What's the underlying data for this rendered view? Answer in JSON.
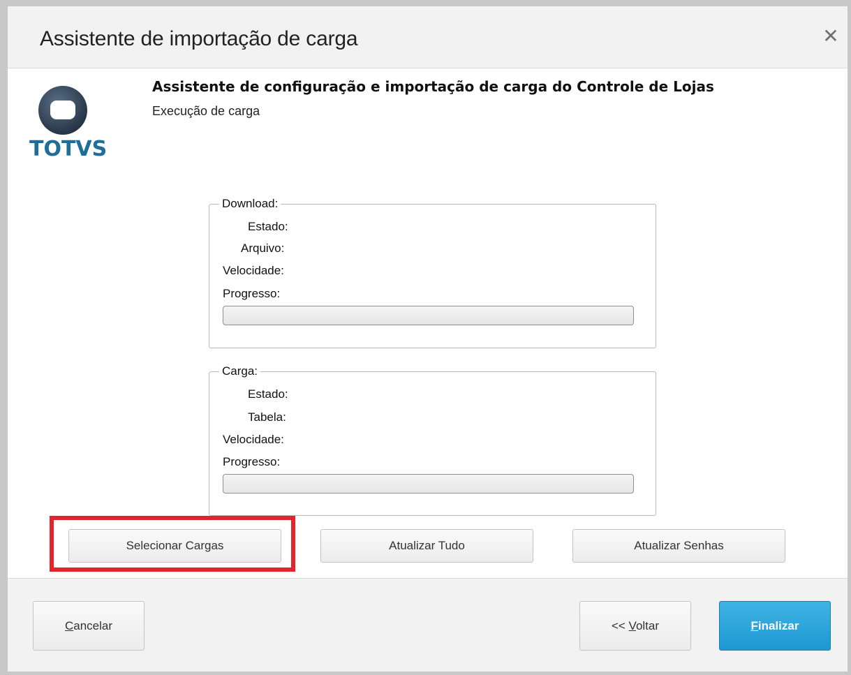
{
  "dialog": {
    "title": "Assistente de importação de carga",
    "close_icon": "close-icon",
    "logo_text": "TOTVS",
    "heading": "Assistente de configuração e importação de carga do Controle de Lojas",
    "subheading": "Execução de carga"
  },
  "download": {
    "legend": "Download:",
    "estado_label": "Estado:",
    "arquivo_label": "Arquivo:",
    "velocidade_label": "Velocidade:",
    "progresso_label": "Progresso:",
    "progress": 0
  },
  "carga": {
    "legend": "Carga:",
    "estado_label": "Estado:",
    "tabela_label": "Tabela:",
    "velocidade_label": "Velocidade:",
    "progresso_label": "Progresso:",
    "progress": 0
  },
  "actions": {
    "selecionar_cargas": "Selecionar Cargas",
    "atualizar_tudo": "Atualizar Tudo",
    "atualizar_senhas": "Atualizar Senhas"
  },
  "footer": {
    "cancelar_prefix": "",
    "cancelar_mnemonic": "C",
    "cancelar_rest": "ancelar",
    "voltar_prefix": "<< ",
    "voltar_mnemonic": "V",
    "voltar_rest": "oltar",
    "finalizar_mnemonic": "F",
    "finalizar_rest": "inalizar"
  },
  "colors": {
    "highlight": "#e3242b",
    "primary": "#1e98d1",
    "logo": "#1e6d9a"
  }
}
